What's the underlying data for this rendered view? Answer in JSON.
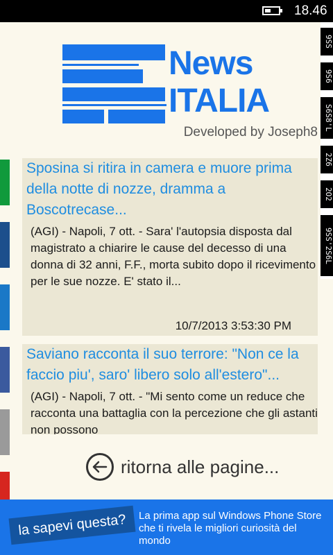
{
  "status": {
    "time": "18.46"
  },
  "logo": {
    "line1": "News",
    "line2": "ITALIA",
    "developer": "Developed by Joseph8"
  },
  "ticker": [
    "9SS",
    "9S6",
    "S6S8'L",
    "2Z6",
    "2O2",
    "9SS'2S6L"
  ],
  "left_strips": [
    {
      "color": "#109a3c"
    },
    {
      "color": "#1c4f8c"
    },
    {
      "color": "#1a78c7"
    },
    {
      "color": "#3b5a9e"
    },
    {
      "color": "#9a9a9a"
    },
    {
      "color": "#d6261f"
    }
  ],
  "news": [
    {
      "title": "Sposina si ritira in camera e muore prima della notte di nozze, dramma a Boscotrecase...",
      "description": "(AGI) - Napoli, 7 ott. - Sara' l'autopsia disposta dal magistrato a chiarire le cause del decesso di una donna di 32 anni, F.F., morta subito dopo il ricevimento per le sue nozze. E' stato il...",
      "date": "10/7/2013 3:53:30 PM"
    },
    {
      "title": "Saviano racconta il suo terrore: \"Non ce la faccio piu', saro' libero solo all'estero\"...",
      "description": "(AGI) - Napoli, 7 ott. - \"Mi sento come un reduce che racconta una battaglia con la percezione che gli astanti non possono"
    }
  ],
  "back": {
    "label": "ritorna alle pagine..."
  },
  "ad": {
    "badge": "la sapevi questa?",
    "text": "La prima app sul Windows Phone Store che ti rivela le migliori curiosità del mondo"
  },
  "colors": {
    "brand_blue": "#1a74e8",
    "link_blue": "#1f8de0",
    "card_bg": "#ebe7d4"
  }
}
